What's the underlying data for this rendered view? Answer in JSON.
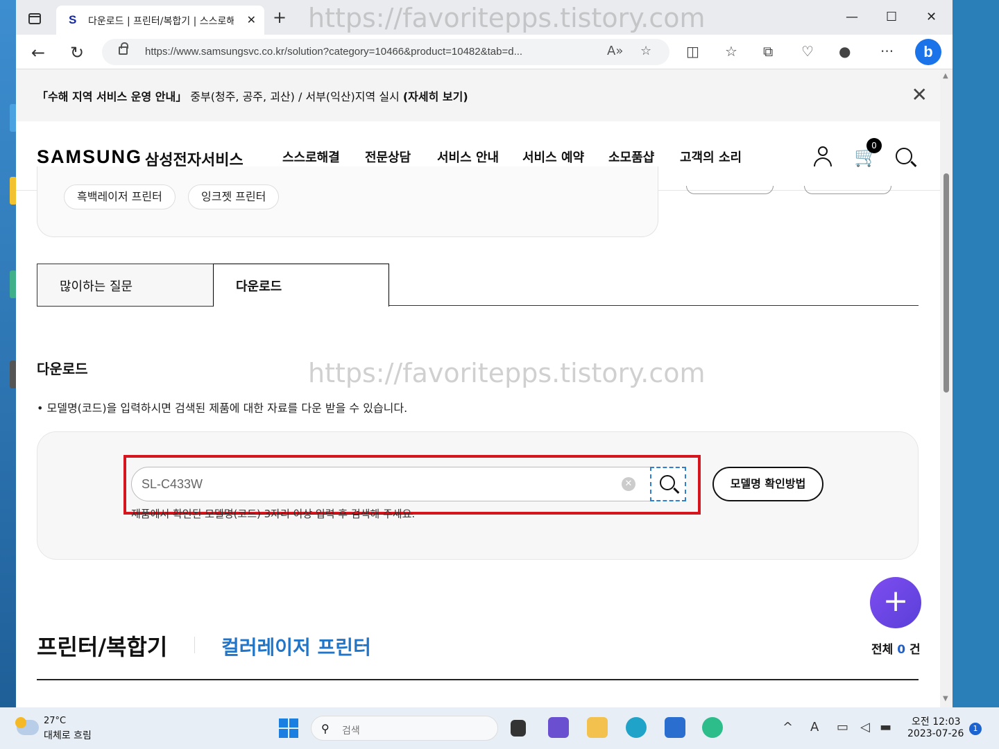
{
  "browser": {
    "tab_favicon": "S",
    "tab_title": "다운로드 | 프린터/복합기 | 스스로해결",
    "url": "https://www.samsungsvc.co.kr/solution?category=10466&product=10482&tab=d...",
    "window_controls": [
      "—",
      "☐",
      "✕"
    ]
  },
  "notice": {
    "strong_prefix": "「수해 지역 서비스 운영 안내」",
    "text": " 중부(청주, 공주, 괴산) / 서부(익산)지역 실시 ",
    "link": "(자세히 보기)"
  },
  "header": {
    "logo": "SAMSUNG",
    "logo_sub": "삼성전자서비스",
    "menu": [
      "스스로해결",
      "전문상담",
      "서비스 안내",
      "서비스 예약",
      "소모품샵",
      "고객의 소리"
    ],
    "cart_count": "0"
  },
  "categories": {
    "chips": [
      "흑백레이저 프린터",
      "잉크젯 프린터"
    ]
  },
  "tabs": {
    "faq": "많이하는 질문",
    "download": "다운로드"
  },
  "download": {
    "title": "다운로드",
    "description": "• 모델명(코드)을 입력하시면 검색된 제품에 대한 자료를 다운 받을 수 있습니다.",
    "input_value": "SL-C433W",
    "help_text": "제품에서 확인된 모델명(코드) 3자리 이상 입력 후 검색해 주세요.",
    "model_help_button": "모델명 확인방법"
  },
  "result": {
    "category_main": "프린터/복합기",
    "category_sub": "컬러레이저 프린터",
    "total_prefix": "전체 ",
    "total_count": "0",
    "total_suffix": " 건"
  },
  "watermark": "https://favoritepps.tistory.com",
  "taskbar": {
    "temperature": "27°C",
    "weather": "대체로 흐림",
    "search_placeholder": "검색",
    "time": "오전 12:03",
    "date": "2023-07-26",
    "notification_count": "1"
  },
  "colors": {
    "accent_blue": "#2075c8",
    "highlight_red": "#d6161f",
    "fab_purple": "#6b45e6"
  }
}
